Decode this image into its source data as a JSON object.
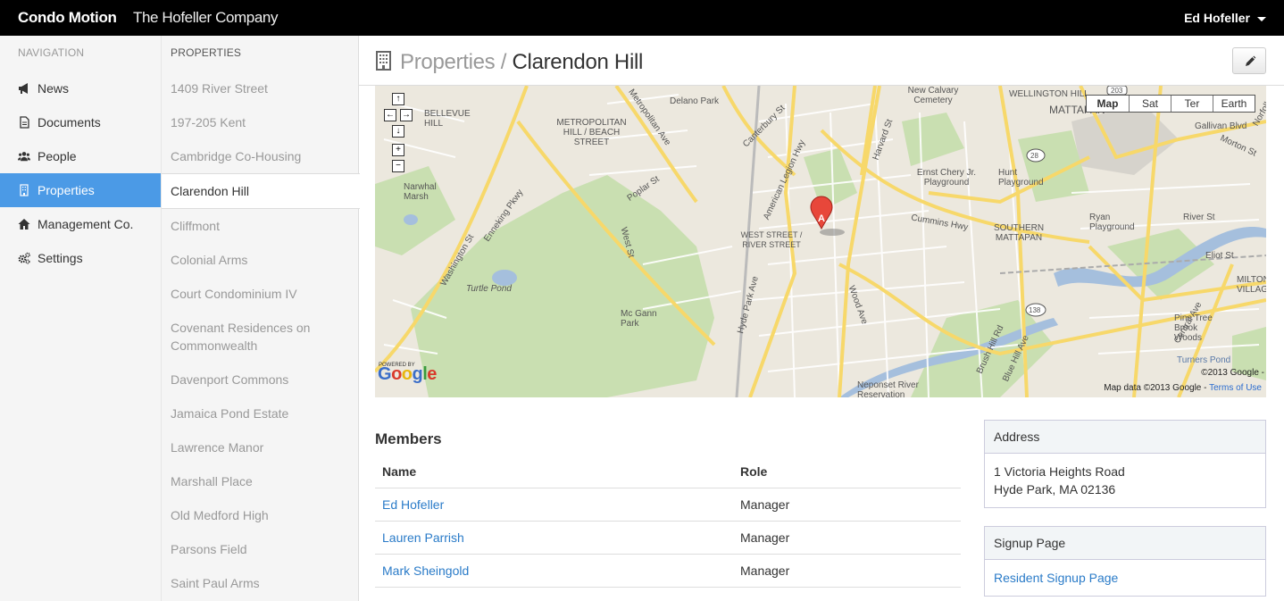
{
  "header": {
    "brand": "Condo Motion",
    "company": "The Hofeller Company",
    "user": "Ed Hofeller"
  },
  "navigation": {
    "heading": "NAVIGATION",
    "items": [
      {
        "label": "News",
        "icon": "bullhorn-icon",
        "active": false
      },
      {
        "label": "Documents",
        "icon": "document-icon",
        "active": false
      },
      {
        "label": "People",
        "icon": "group-icon",
        "active": false
      },
      {
        "label": "Properties",
        "icon": "building-icon",
        "active": true
      },
      {
        "label": "Management Co.",
        "icon": "home-icon",
        "active": false
      },
      {
        "label": "Settings",
        "icon": "cogs-icon",
        "active": false
      }
    ]
  },
  "properties": {
    "heading": "PROPERTIES",
    "items": [
      "1409 River Street",
      "197-205 Kent",
      "Cambridge Co-Housing",
      "Clarendon Hill",
      "Cliffmont",
      "Colonial Arms",
      "Court Condominium IV",
      "Covenant Residences on Commonwealth",
      "Davenport Commons",
      "Jamaica Pond Estate",
      "Lawrence Manor",
      "Marshall Place",
      "Old Medford High",
      "Parsons Field",
      "Saint Paul Arms"
    ],
    "active": "Clarendon Hill"
  },
  "page": {
    "breadcrumb": "Properties",
    "separator": " / ",
    "title": "Clarendon Hill"
  },
  "map": {
    "type_buttons": [
      "Map",
      "Sat",
      "Ter",
      "Earth"
    ],
    "marker": "A",
    "labels": [
      "WELLINGTON HILL",
      "MATTAPAN",
      "New Calvary Cemetery",
      "Delano Park",
      "BELLEVUE HILL",
      "METROPOLITAN HILL / BEACH STREET",
      "Metropolitan Ave",
      "Canterbury St",
      "Cummins Hwy",
      "Harvard St",
      "American Legion Hwy",
      "Ernst Chery Jr. Playground",
      "Hunt Playground",
      "Norfolk St",
      "Gallivan Blvd",
      "Morton St",
      "Narwhal Marsh",
      "Enneking Pkwy",
      "Washington St",
      "Poplar St",
      "West St",
      "WEST STREET / RIVER STREET",
      "SOUTHERN MATTAPAN",
      "Ryan Playground",
      "River St",
      "Eliot St",
      "Turtle Pond",
      "Mc Gann Park",
      "Hyde Park Ave",
      "Wood Ave",
      "Brush Hill Rd",
      "Blue Hill Ave",
      "Central Ave",
      "Pine Tree Brook Woods",
      "MILTON VILLAGE",
      "Neponset River Reservation",
      "Turners Pond"
    ],
    "route_shields": [
      "203",
      "28",
      "138"
    ],
    "copyright": "©2013 Google -",
    "map_data": "Map data ©2013 Google -",
    "terms": "Terms of Use",
    "powered_by": "POWERED BY",
    "logo": "Google"
  },
  "members": {
    "title": "Members",
    "columns": [
      "Name",
      "Role"
    ],
    "rows": [
      {
        "name": "Ed Hofeller",
        "role": "Manager"
      },
      {
        "name": "Lauren Parrish",
        "role": "Manager"
      },
      {
        "name": "Mark Sheingold",
        "role": "Manager"
      }
    ]
  },
  "address_panel": {
    "title": "Address",
    "line1": "1 Victoria Heights Road",
    "line2": "Hyde Park, MA 02136"
  },
  "signup_panel": {
    "title": "Signup Page",
    "link": "Resident Signup Page"
  },
  "colors": {
    "accent": "#4b9ae6",
    "link": "#2a7bc8",
    "navbar": "#000000"
  }
}
